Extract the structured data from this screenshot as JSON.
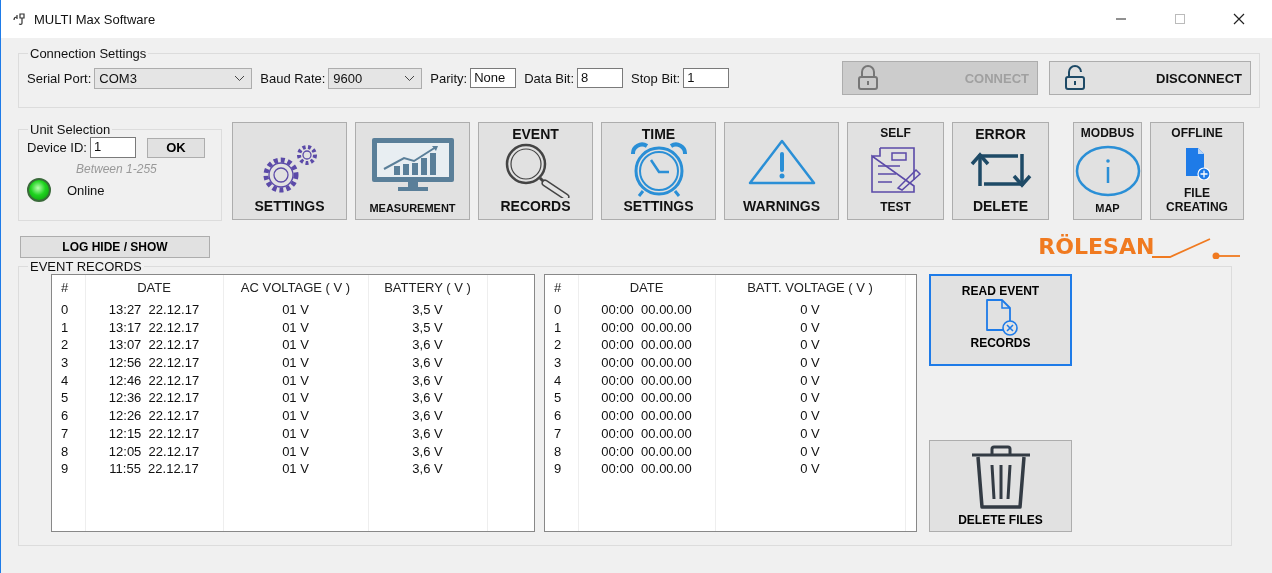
{
  "window": {
    "title": "MULTI Max Software"
  },
  "connection_settings": {
    "legend": "Connection Settings",
    "fields": [
      {
        "label": "Serial Port:",
        "value": "COM3",
        "kind": "dropdown"
      },
      {
        "label": "Baud Rate:",
        "value": "9600",
        "kind": "dropdown"
      },
      {
        "label": "Parity:",
        "value": "None",
        "kind": "text"
      },
      {
        "label": "Data Bit:",
        "value": "8",
        "kind": "text"
      },
      {
        "label": "Stop Bit:",
        "value": "1",
        "kind": "text"
      }
    ],
    "buttons": [
      {
        "label": "CONNECT",
        "disabled": true,
        "kind": "locked"
      },
      {
        "label": "DISCONNECT",
        "disabled": false,
        "kind": "unlocked"
      }
    ]
  },
  "unit_selection": {
    "legend": "Unit Selection",
    "device_id_label": "Device ID:",
    "device_id": "1",
    "ok_button": "OK",
    "hint": "Between 1-255",
    "status": {
      "label": "Online",
      "on": true
    }
  },
  "tool_buttons": [
    {
      "bottom": "SETTINGS"
    },
    {
      "bottom": "MEASUREMENT"
    },
    {
      "top": "EVENT",
      "bottom": "RECORDS"
    },
    {
      "top": "TIME",
      "bottom": "SETTINGS"
    },
    {
      "bottom": "WARNINGS"
    },
    {
      "top": "SELF",
      "bottom": "TEST"
    },
    {
      "top": "ERROR",
      "bottom": "DELETE"
    },
    {
      "top": "MODBUS",
      "bottom": "MAP"
    },
    {
      "top": "OFFLINE",
      "bottom": "FILE CREATING"
    }
  ],
  "log_button": "LOG HIDE / SHOW",
  "logo": "RÖLESAN",
  "event_records": {
    "legend": "EVENT RECORDS",
    "tables": [
      {
        "columns": [
          "#",
          "DATE",
          "AC VOLTAGE ( V )",
          "BATTERY ( V )"
        ],
        "rows": [
          [
            "0",
            "13:27  22.12.17",
            "01 V",
            "3,5 V"
          ],
          [
            "1",
            "13:17  22.12.17",
            "01 V",
            "3,5 V"
          ],
          [
            "2",
            "13:07  22.12.17",
            "01 V",
            "3,6 V"
          ],
          [
            "3",
            "12:56  22.12.17",
            "01 V",
            "3,6 V"
          ],
          [
            "4",
            "12:46  22.12.17",
            "01 V",
            "3,6 V"
          ],
          [
            "5",
            "12:36  22.12.17",
            "01 V",
            "3,6 V"
          ],
          [
            "6",
            "12:26  22.12.17",
            "01 V",
            "3,6 V"
          ],
          [
            "7",
            "12:15  22.12.17",
            "01 V",
            "3,6 V"
          ],
          [
            "8",
            "12:05  22.12.17",
            "01 V",
            "3,6 V"
          ],
          [
            "9",
            "11:55  22.12.17",
            "01 V",
            "3,6 V"
          ]
        ]
      },
      {
        "columns": [
          "#",
          "DATE",
          "BATT. VOLTAGE ( V )"
        ],
        "rows": [
          [
            "0",
            "00:00  00.00.00",
            "0 V"
          ],
          [
            "1",
            "00:00  00.00.00",
            "0 V"
          ],
          [
            "2",
            "00:00  00.00.00",
            "0 V"
          ],
          [
            "3",
            "00:00  00.00.00",
            "0 V"
          ],
          [
            "4",
            "00:00  00.00.00",
            "0 V"
          ],
          [
            "5",
            "00:00  00.00.00",
            "0 V"
          ],
          [
            "6",
            "00:00  00.00.00",
            "0 V"
          ],
          [
            "7",
            "00:00  00.00.00",
            "0 V"
          ],
          [
            "8",
            "00:00  00.00.00",
            "0 V"
          ],
          [
            "9",
            "00:00  00.00.00",
            "0 V"
          ]
        ]
      }
    ],
    "read_button": {
      "top": "READ EVENT",
      "bottom": "RECORDS",
      "selected": true
    },
    "delete_button": "DELETE FILES"
  }
}
